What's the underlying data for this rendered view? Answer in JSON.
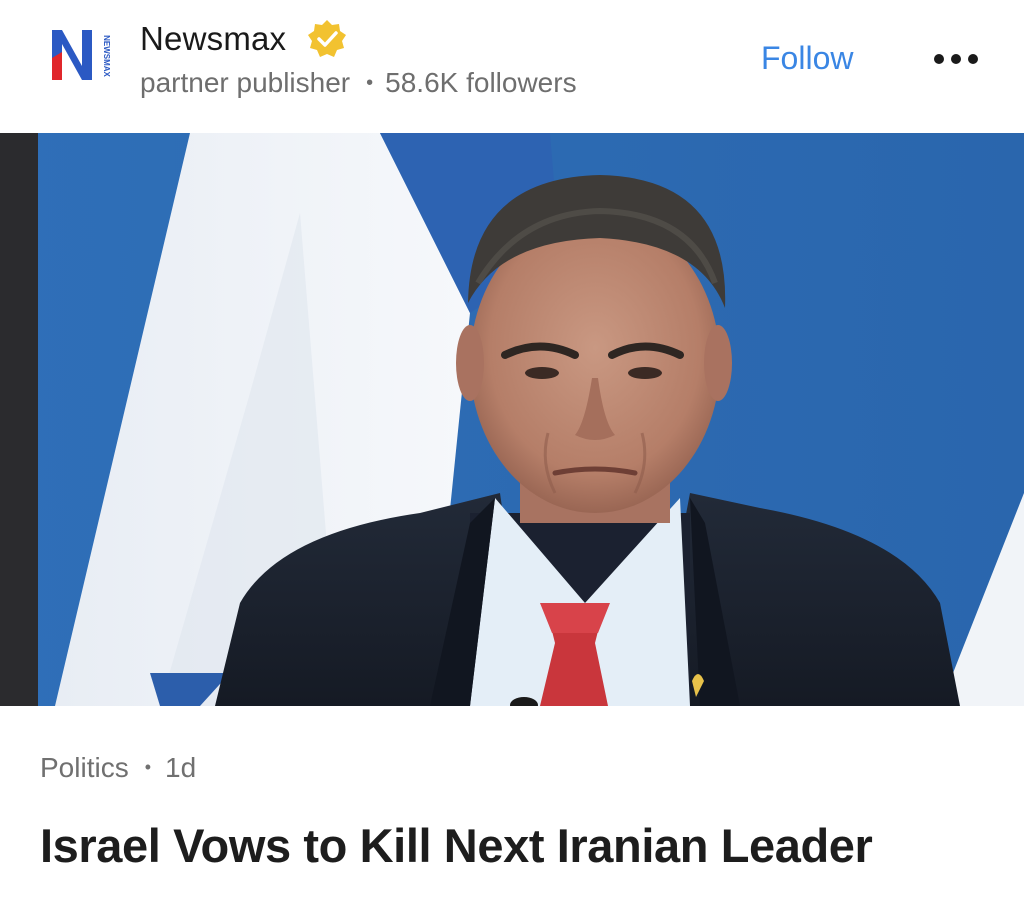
{
  "publisher": {
    "name": "Newsmax",
    "logo_text": "NEWSMAX",
    "logo_letter": "N",
    "type": "partner publisher",
    "followers": "58.6K followers",
    "verified_icon": "verified-badge-icon",
    "badge_color": "#f2c230",
    "logo_blue": "#2b59c3",
    "logo_red": "#e0262b"
  },
  "actions": {
    "follow_label": "Follow",
    "follow_color": "#3a86e4",
    "more_icon": "more-horizontal-icon"
  },
  "article": {
    "category": "Politics",
    "age": "1d",
    "headline": "Israel Vows to Kill Next Iranian Leader",
    "image_icon": "article-photo"
  }
}
